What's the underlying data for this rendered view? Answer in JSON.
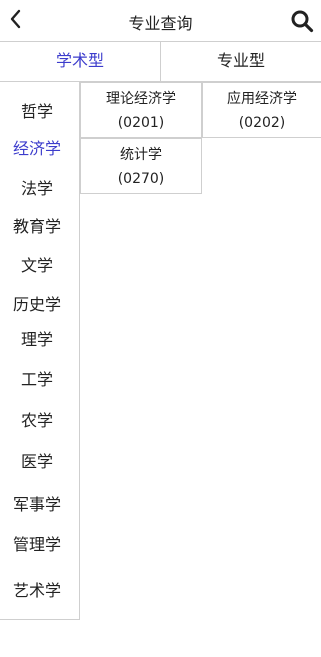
{
  "header": {
    "title": "专业查询",
    "back_icon": "chevron-left-icon",
    "search_icon": "search-icon"
  },
  "tabs": [
    {
      "label": "学术型",
      "active": true
    },
    {
      "label": "专业型",
      "active": false
    }
  ],
  "sidebar": {
    "items": [
      {
        "label": "哲学",
        "active": false
      },
      {
        "label": "经济学",
        "active": true
      },
      {
        "label": "法学",
        "active": false
      },
      {
        "label": "教育学",
        "active": false
      },
      {
        "label": "文学",
        "active": false
      },
      {
        "label": "历史学",
        "active": false
      },
      {
        "label": "理学",
        "active": false
      },
      {
        "label": "工学",
        "active": false
      },
      {
        "label": "农学",
        "active": false
      },
      {
        "label": "医学",
        "active": false
      },
      {
        "label": "军事学",
        "active": false
      },
      {
        "label": "管理学",
        "active": false
      },
      {
        "label": "艺术学",
        "active": false
      }
    ]
  },
  "majors": [
    {
      "name": "理论经济学",
      "code": "(0201)"
    },
    {
      "name": "应用经济学",
      "code": "(0202)"
    },
    {
      "name": "统计学",
      "code": "(0270)"
    }
  ],
  "colors": {
    "accent": "#3c3ccc",
    "border": "#cfcfcf",
    "text": "#222222"
  }
}
